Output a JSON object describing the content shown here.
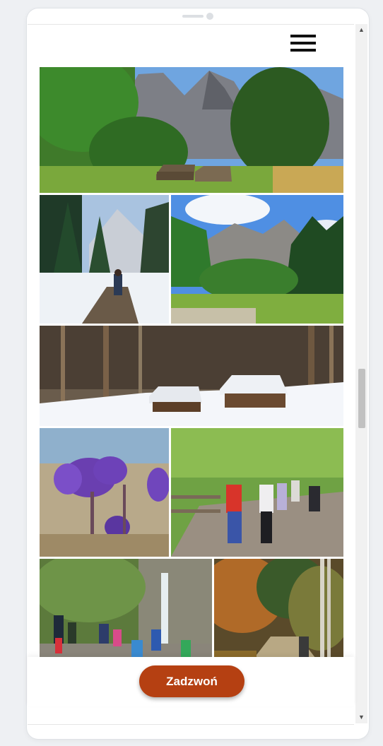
{
  "header": {
    "menu_icon": "hamburger-menu-icon"
  },
  "gallery": {
    "photos": [
      {
        "name": "photo-mountain-valley-huts",
        "interactable": true
      },
      {
        "name": "photo-winter-trail-hiker",
        "interactable": true
      },
      {
        "name": "photo-mountain-meadow-forest",
        "interactable": true
      },
      {
        "name": "photo-snowy-huts-forest",
        "interactable": true
      },
      {
        "name": "photo-purple-flower",
        "interactable": true
      },
      {
        "name": "photo-hikers-boardwalk",
        "interactable": true
      },
      {
        "name": "photo-children-waterfall",
        "interactable": true
      },
      {
        "name": "photo-autumn-forest-path",
        "interactable": true
      }
    ]
  },
  "footer": {
    "call_label": "Zadzwoń"
  },
  "scrollbar": {
    "up_icon": "scroll-up-arrow-icon",
    "down_icon": "scroll-down-arrow-icon"
  }
}
